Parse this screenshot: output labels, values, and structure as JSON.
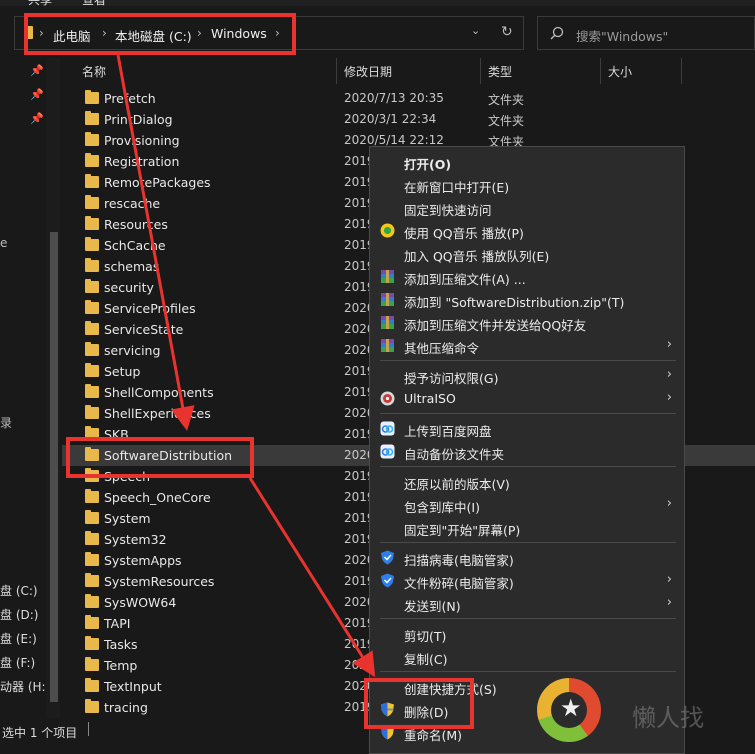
{
  "ribbon": {
    "share_label": "共享",
    "view_label": "查看"
  },
  "address": {
    "crumbs": [
      "此电脑",
      "本地磁盘 (C:)",
      "Windows"
    ],
    "search_placeholder": "搜索\"Windows\""
  },
  "sidebar": {
    "drives": [
      "盘 (C:)",
      "盘 (D:)",
      "盘 (E:)",
      "盘 (F:)",
      "动器 (H:)"
    ]
  },
  "columns": {
    "name": "名称",
    "date": "修改日期",
    "type": "类型",
    "size": "大小"
  },
  "files": [
    {
      "name": "Prefetch",
      "date": "2020/7/13 20:35",
      "type": "文件夹"
    },
    {
      "name": "PrintDialog",
      "date": "2020/3/1 22:34",
      "type": "文件夹"
    },
    {
      "name": "Provisioning",
      "date": "2020/5/14 22:12",
      "type": "文件夹"
    },
    {
      "name": "Registration",
      "date": "2019",
      "type": ""
    },
    {
      "name": "RemotePackages",
      "date": "2019",
      "type": ""
    },
    {
      "name": "rescache",
      "date": "2019",
      "type": ""
    },
    {
      "name": "Resources",
      "date": "2019",
      "type": ""
    },
    {
      "name": "SchCache",
      "date": "2019",
      "type": ""
    },
    {
      "name": "schemas",
      "date": "2019",
      "type": ""
    },
    {
      "name": "security",
      "date": "2019",
      "type": ""
    },
    {
      "name": "ServiceProfiles",
      "date": "2020",
      "type": ""
    },
    {
      "name": "ServiceState",
      "date": "2020",
      "type": ""
    },
    {
      "name": "servicing",
      "date": "2020",
      "type": ""
    },
    {
      "name": "Setup",
      "date": "2019",
      "type": ""
    },
    {
      "name": "ShellComponents",
      "date": "2019",
      "type": ""
    },
    {
      "name": "ShellExperiences",
      "date": "2020",
      "type": ""
    },
    {
      "name": "SKB",
      "date": "2019",
      "type": ""
    },
    {
      "name": "SoftwareDistribution",
      "date": "2020",
      "type": ""
    },
    {
      "name": "Speech",
      "date": "2019",
      "type": ""
    },
    {
      "name": "Speech_OneCore",
      "date": "2019",
      "type": ""
    },
    {
      "name": "System",
      "date": "2019",
      "type": ""
    },
    {
      "name": "System32",
      "date": "2019",
      "type": ""
    },
    {
      "name": "SystemApps",
      "date": "2020",
      "type": ""
    },
    {
      "name": "SystemResources",
      "date": "2019",
      "type": ""
    },
    {
      "name": "SysWOW64",
      "date": "2020",
      "type": ""
    },
    {
      "name": "TAPI",
      "date": "2019",
      "type": ""
    },
    {
      "name": "Tasks",
      "date": "2019",
      "type": ""
    },
    {
      "name": "Temp",
      "date": "2020",
      "type": ""
    },
    {
      "name": "TextInput",
      "date": "2020",
      "type": ""
    },
    {
      "name": "tracing",
      "date": "2019",
      "type": ""
    }
  ],
  "status": {
    "selection": "选中 1 个项目"
  },
  "context_menu": {
    "items": [
      {
        "label": "打开(O)",
        "icon": ""
      },
      {
        "label": "在新窗口中打开(E)",
        "icon": ""
      },
      {
        "label": "固定到快速访问",
        "icon": ""
      },
      {
        "label": "使用 QQ音乐 播放(P)",
        "icon": "qqmusic-icon"
      },
      {
        "label": "加入 QQ音乐 播放队列(E)",
        "icon": ""
      },
      {
        "label": "添加到压缩文件(A) ...",
        "icon": "winrar-icon"
      },
      {
        "label": "添加到 \"SoftwareDistribution.zip\"(T)",
        "icon": "winrar-icon"
      },
      {
        "label": "添加到压缩文件并发送给QQ好友",
        "icon": "winrar-icon"
      },
      {
        "label": "其他压缩命令",
        "icon": "winrar-icon",
        "submenu": true
      },
      {
        "label": "授予访问权限(G)",
        "icon": "",
        "submenu": true
      },
      {
        "label": "UltraISO",
        "icon": "ultraiso-icon",
        "submenu": true
      },
      {
        "label": "上传到百度网盘",
        "icon": "baidu-icon"
      },
      {
        "label": "自动备份该文件夹",
        "icon": "baidu-icon"
      },
      {
        "label": "还原以前的版本(V)",
        "icon": ""
      },
      {
        "label": "包含到库中(I)",
        "icon": "",
        "submenu": true
      },
      {
        "label": "固定到\"开始\"屏幕(P)",
        "icon": ""
      },
      {
        "label": "扫描病毒(电脑管家)",
        "icon": "shield-icon"
      },
      {
        "label": "文件粉碎(电脑管家)",
        "icon": "shield-icon",
        "submenu": true
      },
      {
        "label": "发送到(N)",
        "icon": "",
        "submenu": true
      },
      {
        "label": "剪切(T)",
        "icon": ""
      },
      {
        "label": "复制(C)",
        "icon": ""
      },
      {
        "label": "创建快捷方式(S)",
        "icon": ""
      },
      {
        "label": "删除(D)",
        "icon": "uac-shield-icon"
      },
      {
        "label": "重命名(M)",
        "icon": "uac-shield-icon"
      }
    ],
    "arrow_glyph": "›"
  },
  "watermark": {
    "text": "懒人找"
  },
  "colors": {
    "highlight": "#e8332e",
    "folder": "#e8b94a",
    "selected_row": "#3a3a3a"
  }
}
